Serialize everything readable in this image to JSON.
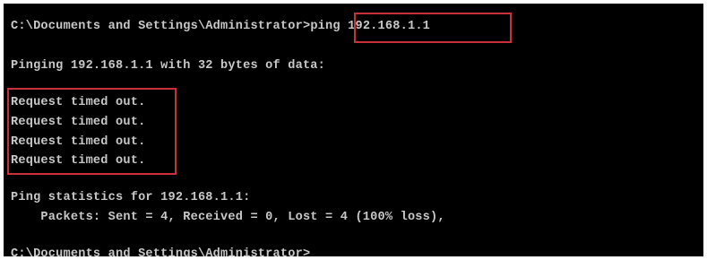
{
  "console": {
    "prompt": "C:\\Documents and Settings\\Administrator>",
    "command": "ping 192.168.1.1",
    "pinging_line": "Pinging 192.168.1.1 with 32 bytes of data:",
    "request_lines": [
      "Request timed out.",
      "Request timed out.",
      "Request timed out.",
      "Request timed out."
    ],
    "stats_header": "Ping statistics for 192.168.1.1:",
    "packets_line": "    Packets: Sent = 4, Received = 0, Lost = 4 (100% loss),",
    "final_prompt": "C:\\Documents and Settings\\Administrator>"
  },
  "colors": {
    "background": "#000000",
    "text": "#c8c8c8",
    "highlight_border": "#c8303a"
  }
}
